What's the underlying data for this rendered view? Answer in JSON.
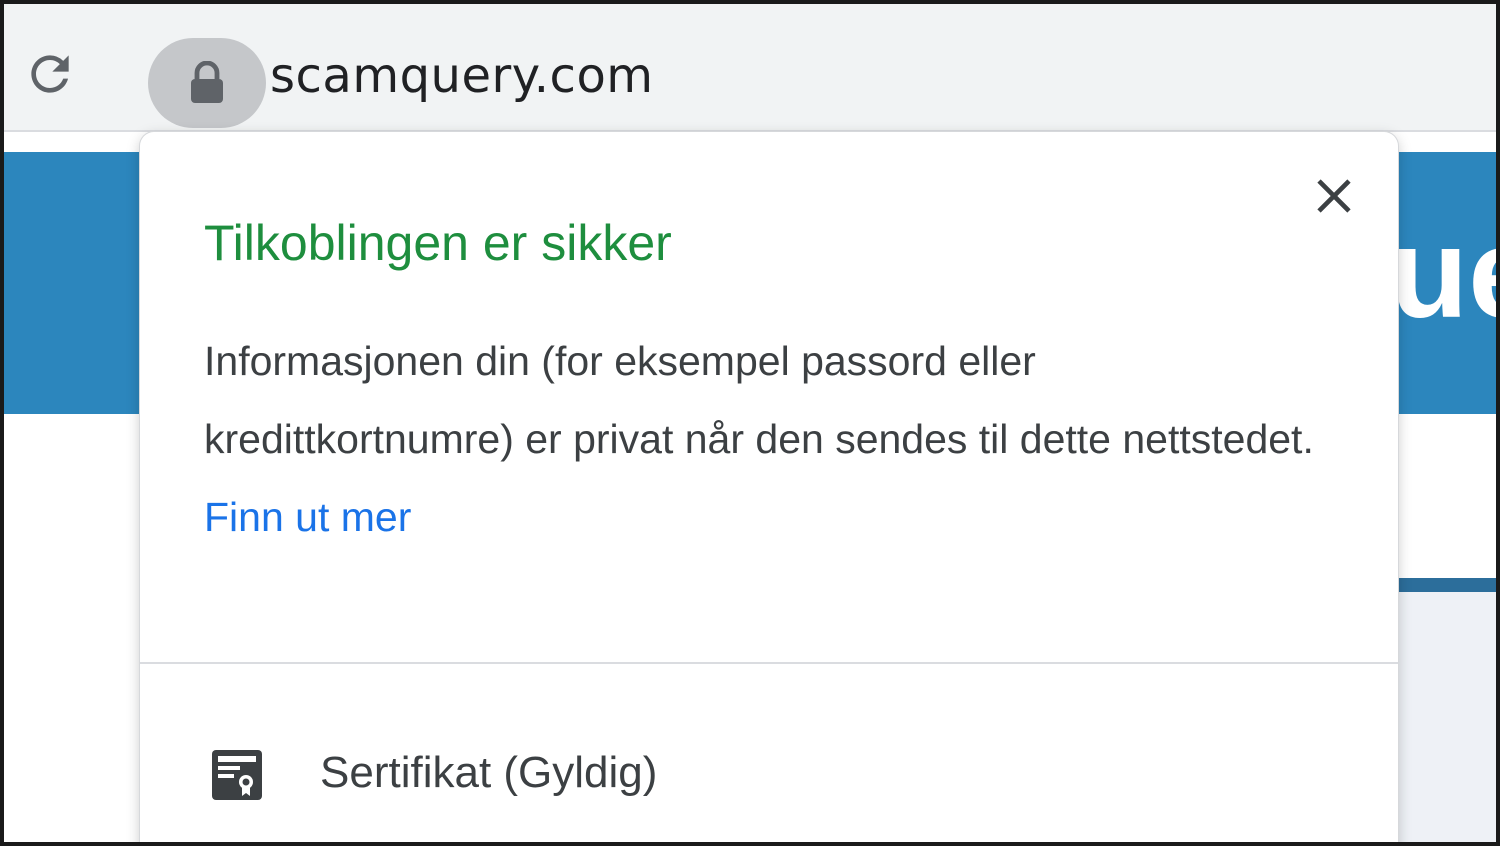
{
  "browser": {
    "url": "scamquery.com",
    "reload_icon": "reload-icon",
    "lock_icon": "lock-icon"
  },
  "page": {
    "banner_text": "ue",
    "banner_color": "#2c86bd"
  },
  "popup": {
    "title": "Tilkoblingen er sikker",
    "description": "Informasjonen din (for eksempel passord eller kredittkortnumre) er privat når den sendes til dette nettstedet.",
    "learn_more": "Finn ut mer",
    "close_icon": "close-icon",
    "certificate": {
      "icon": "certificate-icon",
      "label": "Sertifikat",
      "status": "(Gyldig)"
    },
    "colors": {
      "title": "#1e8e3e",
      "link": "#1a73e8"
    }
  }
}
